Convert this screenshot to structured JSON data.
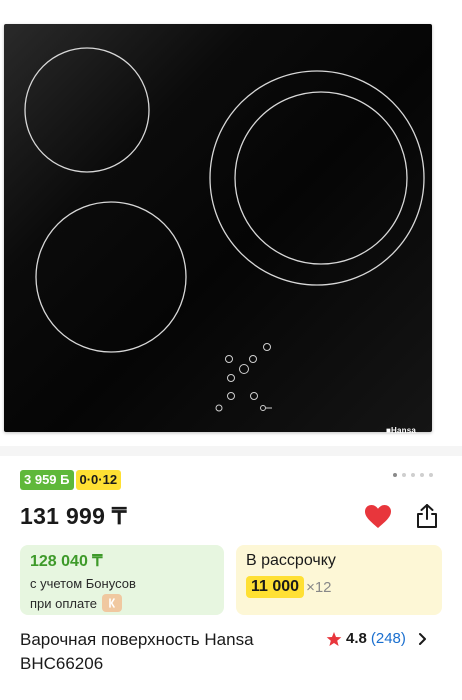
{
  "product": {
    "image_alt": "Hansa BHC66206 cooktop",
    "brand_logo": "■Hansa",
    "title": "Варочная поверхность Hansa BHC66206",
    "price": "131 999 ₸"
  },
  "badges": {
    "bonus": "3 959 Б",
    "installment": "0·0·12"
  },
  "gallery": {
    "count": 5,
    "active": 0
  },
  "bonus_card": {
    "price": "128 040 ₸",
    "caption": "с учетом Бонусов",
    "payment_label": "при оплате"
  },
  "installment_card": {
    "title": "В рассрочку",
    "amount": "11 000",
    "multiplier": "×12"
  },
  "rating": {
    "value": "4.8",
    "count": "(248)"
  },
  "colors": {
    "favorite": "#e8363c",
    "bonus_green": "#5fb83a",
    "installment_yellow": "#ffe033",
    "link_blue": "#1a6fcf"
  },
  "icons": [
    "heart-icon",
    "share-icon",
    "star-icon",
    "chevron-right-icon",
    "kaspi-icon"
  ]
}
